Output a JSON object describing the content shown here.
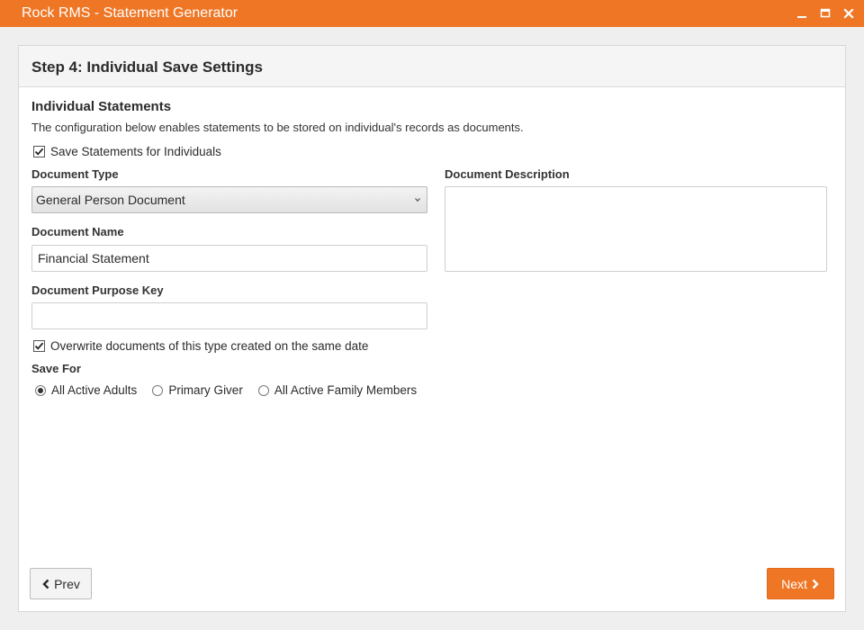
{
  "window": {
    "title": "Rock RMS - Statement Generator",
    "accent_color": "#ee7625",
    "controls": [
      "minimize-icon",
      "maximize-icon",
      "close-icon"
    ]
  },
  "panel": {
    "title": "Step 4: Individual Save Settings"
  },
  "section": {
    "title": "Individual Statements",
    "description": "The configuration below enables statements to be stored on individual's records as documents."
  },
  "save_statements": {
    "label": "Save Statements for Individuals",
    "checked": true
  },
  "document_type": {
    "label": "Document Type",
    "value": "General Person Document"
  },
  "document_name": {
    "label": "Document Name",
    "value": "Financial Statement"
  },
  "document_purpose_key": {
    "label": "Document Purpose Key",
    "value": ""
  },
  "document_description": {
    "label": "Document Description",
    "value": ""
  },
  "overwrite": {
    "label": "Overwrite documents of this type created on the same date",
    "checked": true
  },
  "save_for": {
    "label": "Save For",
    "options": [
      {
        "label": "All Active Adults",
        "selected": true
      },
      {
        "label": "Primary Giver",
        "selected": false
      },
      {
        "label": "All Active Family Members",
        "selected": false
      }
    ]
  },
  "buttons": {
    "prev": "Prev",
    "next": "Next"
  }
}
